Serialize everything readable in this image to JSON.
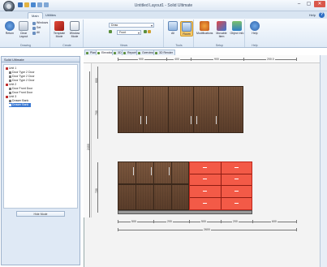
{
  "app": {
    "title": "Untitled Layout1 - Solid Ultimate",
    "window_controls": [
      "–",
      "▢",
      "✕"
    ],
    "colors": {
      "accent": "#3a78d2",
      "wood": "#6b4a34",
      "selection_red": "#f35a47"
    }
  },
  "ribbon_tabs": [
    {
      "label": "Main",
      "active": true
    },
    {
      "label": "Utilities",
      "active": false
    }
  ],
  "ribbon_right": {
    "label": "Help"
  },
  "ribbon": {
    "groups": [
      {
        "label": "Drawing",
        "buttons": [
          "Return",
          "Clear Layout"
        ],
        "small": [
          "Windows",
          "Set",
          "All"
        ]
      },
      {
        "label": "Create",
        "buttons": [
          "Template Mode",
          "Window Mode"
        ]
      },
      {
        "label": "Views",
        "combo1": "Draw",
        "combo2": "Front"
      },
      {
        "label": "Tools",
        "buttons": [
          "All",
          "Room"
        ]
      },
      {
        "label": "Setup",
        "buttons": [
          "Modifications",
          "Movable Item",
          "Object Info"
        ]
      },
      {
        "label": "Help",
        "buttons": [
          "Help"
        ]
      }
    ]
  },
  "left_panel": {
    "title": "Solid Ultimate",
    "tree": [
      {
        "label": "Unit 1",
        "level": 0,
        "mark": "#c03030"
      },
      {
        "label": "Door Type 2 Door",
        "level": 1,
        "mark": "#7a7a7a"
      },
      {
        "label": "Door Type 2 Door",
        "level": 1,
        "mark": "#7a7a7a"
      },
      {
        "label": "Door Type 2 Door",
        "level": 1,
        "mark": "#7a7a7a"
      },
      {
        "label": "Unit 2",
        "level": 0,
        "mark": "#c03030"
      },
      {
        "label": "Door Front Door",
        "level": 1,
        "mark": "#7a7a7a"
      },
      {
        "label": "Door Front Door",
        "level": 1,
        "mark": "#7a7a7a"
      },
      {
        "label": "Unit 3",
        "level": 0,
        "mark": "#c03030"
      },
      {
        "label": "Drawer Bank",
        "level": 1,
        "mark": "#7a7a7a"
      },
      {
        "label": "Drawer Bank",
        "level": 1,
        "mark": "#3a78d2",
        "selected": true
      }
    ],
    "button": "Hide Mode"
  },
  "doc_tabs": [
    {
      "label": "Plan",
      "active": false
    },
    {
      "label": "Elevation",
      "active": true
    },
    {
      "label": "3D",
      "active": false
    },
    {
      "label": "Reports",
      "active": false
    },
    {
      "label": "Overview",
      "active": false
    },
    {
      "label": "3D Render",
      "active": false
    }
  ],
  "drawing": {
    "top_dims": [
      "900",
      "400",
      "900",
      "200.0"
    ],
    "left_dims": [
      "600",
      "700",
      "2400",
      "720"
    ],
    "bottom_dims": [
      "500",
      "200",
      "500",
      "200",
      "600"
    ],
    "bottom_total": "2600"
  }
}
